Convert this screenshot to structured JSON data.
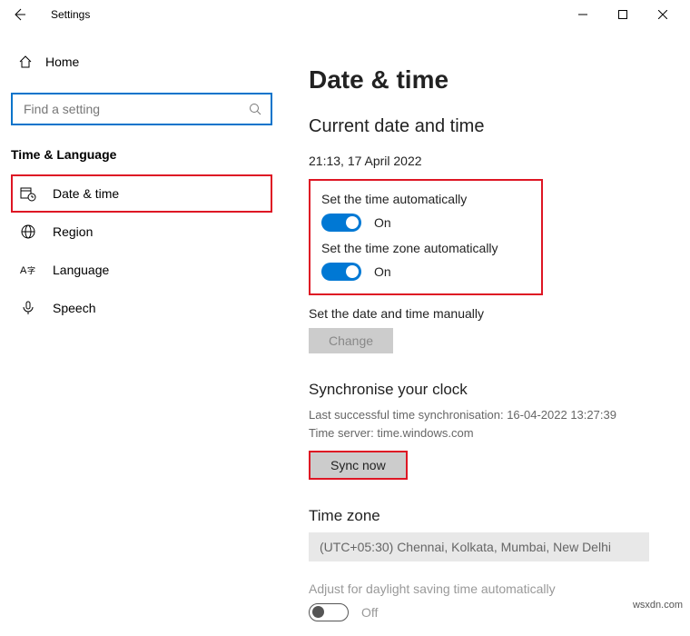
{
  "titlebar": {
    "appName": "Settings"
  },
  "sidebar": {
    "home": "Home",
    "search": {
      "placeholder": "Find a setting"
    },
    "category": "Time & Language",
    "items": [
      {
        "label": "Date & time",
        "icon": "calendar-clock-icon",
        "selected": true
      },
      {
        "label": "Region",
        "icon": "globe-icon",
        "selected": false
      },
      {
        "label": "Language",
        "icon": "language-icon",
        "selected": false
      },
      {
        "label": "Speech",
        "icon": "microphone-icon",
        "selected": false
      }
    ]
  },
  "main": {
    "pageTitle": "Date & time",
    "sectionTitle": "Current date and time",
    "currentDateTime": "21:13, 17 April 2022",
    "autoTime": {
      "label": "Set the time automatically",
      "state": "On"
    },
    "autoTz": {
      "label": "Set the time zone automatically",
      "state": "On"
    },
    "manual": {
      "label": "Set the date and time manually",
      "button": "Change"
    },
    "sync": {
      "title": "Synchronise your clock",
      "lastSync": "Last successful time synchronisation: 16-04-2022 13:27:39",
      "server": "Time server: time.windows.com",
      "button": "Sync now"
    },
    "timezone": {
      "title": "Time zone",
      "value": "(UTC+05:30) Chennai, Kolkata, Mumbai, New Delhi"
    },
    "daylight": {
      "label": "Adjust for daylight saving time automatically",
      "state": "Off"
    }
  },
  "watermark": "wsxdn.com"
}
